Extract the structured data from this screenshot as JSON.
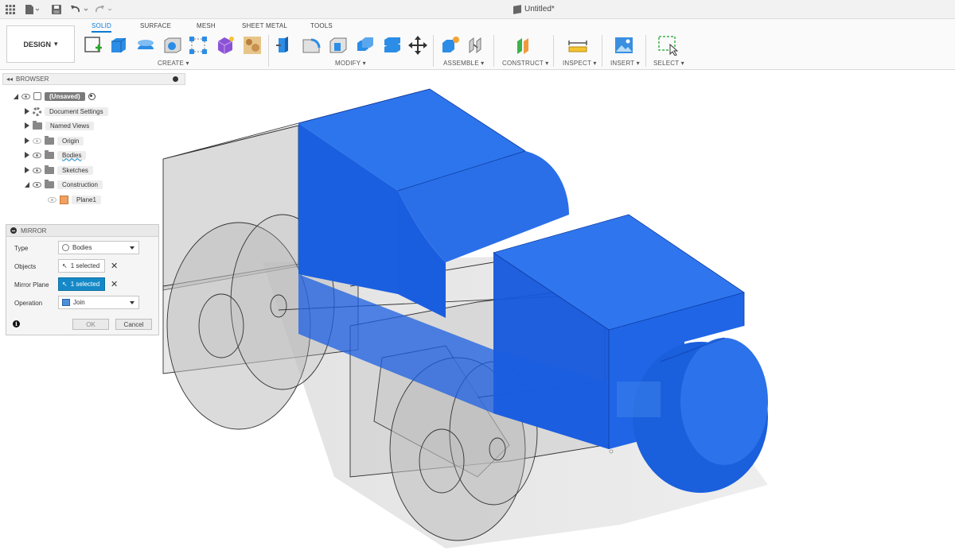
{
  "window": {
    "title": "Untitled*"
  },
  "toolbar": {
    "workspace_label": "DESIGN",
    "tabs": [
      {
        "label": "SOLID",
        "active": true
      },
      {
        "label": "SURFACE",
        "active": false
      },
      {
        "label": "MESH",
        "active": false
      },
      {
        "label": "SHEET METAL",
        "active": false
      },
      {
        "label": "TOOLS",
        "active": false
      }
    ],
    "groups": {
      "create": "CREATE",
      "modify": "MODIFY",
      "assemble": "ASSEMBLE",
      "construct": "CONSTRUCT",
      "inspect": "INSPECT",
      "insert": "INSERT",
      "select": "SELECT"
    }
  },
  "browser": {
    "title": "BROWSER",
    "root": "(Unsaved)",
    "items": [
      {
        "label": "Document Settings",
        "icon": "gear-icon"
      },
      {
        "label": "Named Views",
        "icon": "folder-icon"
      },
      {
        "label": "Origin",
        "icon": "folder-icon"
      },
      {
        "label": "Bodies",
        "icon": "folder-icon"
      },
      {
        "label": "Sketches",
        "icon": "folder-icon"
      },
      {
        "label": "Construction",
        "icon": "folder-icon"
      },
      {
        "label": "Plane1",
        "icon": "plane-icon"
      }
    ]
  },
  "mirror_dialog": {
    "title": "MIRROR",
    "type_label": "Type",
    "type_value": "Bodies",
    "objects_label": "Objects",
    "objects_value": "1 selected",
    "mirror_plane_label": "Mirror Plane",
    "mirror_plane_value": "1 selected",
    "operation_label": "Operation",
    "operation_value": "Join",
    "ok_label": "OK",
    "cancel_label": "Cancel"
  },
  "colors": {
    "accent": "#0b7ad1",
    "body_blue": "#1f66e6",
    "selection_blue": "#1589c7"
  }
}
